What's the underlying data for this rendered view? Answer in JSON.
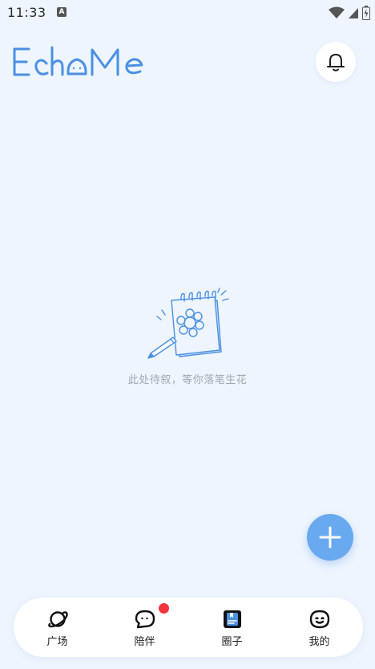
{
  "status_bar": {
    "time": "11:33",
    "notification_letter": "A",
    "icons": [
      "wifi-icon",
      "signal-icon",
      "battery-icon"
    ]
  },
  "header": {
    "logo_text": "EchoMe",
    "bell_icon": "bell-icon"
  },
  "empty_state": {
    "illustration": "notebook-pencil-icon",
    "message": "此处待叙，等你落笔生花"
  },
  "fab": {
    "icon": "plus-icon"
  },
  "bottom_nav": {
    "items": [
      {
        "label": "广场",
        "icon": "planet-icon",
        "badge": false
      },
      {
        "label": "陪伴",
        "icon": "chat-bubble-icon",
        "badge": true
      },
      {
        "label": "圈子",
        "icon": "card-icon",
        "badge": false
      },
      {
        "label": "我的",
        "icon": "smile-face-icon",
        "badge": false
      }
    ]
  },
  "colors": {
    "background": "#eef5fe",
    "accent": "#68a9ef",
    "logo": "#4a90e2",
    "badge": "#f2353d",
    "muted_text": "#a2a8b0"
  }
}
